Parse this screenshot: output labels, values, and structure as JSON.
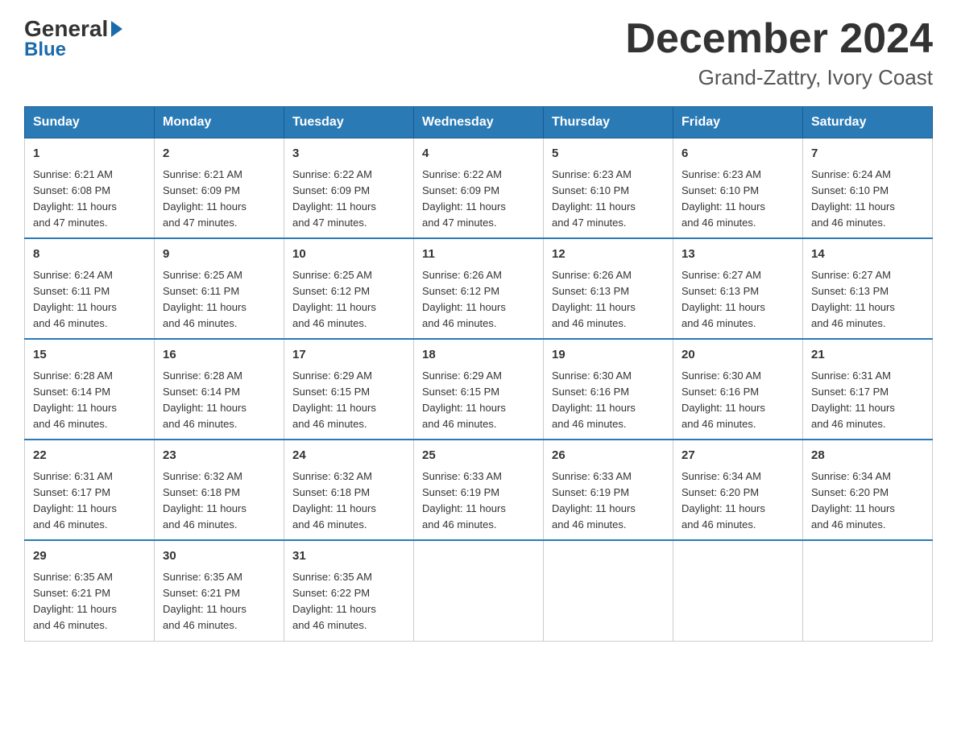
{
  "header": {
    "logo_general": "General",
    "logo_blue": "Blue",
    "month_title": "December 2024",
    "location": "Grand-Zattry, Ivory Coast"
  },
  "days_of_week": [
    "Sunday",
    "Monday",
    "Tuesday",
    "Wednesday",
    "Thursday",
    "Friday",
    "Saturday"
  ],
  "weeks": [
    [
      {
        "day": "1",
        "sunrise": "6:21 AM",
        "sunset": "6:08 PM",
        "daylight": "11 hours and 47 minutes."
      },
      {
        "day": "2",
        "sunrise": "6:21 AM",
        "sunset": "6:09 PM",
        "daylight": "11 hours and 47 minutes."
      },
      {
        "day": "3",
        "sunrise": "6:22 AM",
        "sunset": "6:09 PM",
        "daylight": "11 hours and 47 minutes."
      },
      {
        "day": "4",
        "sunrise": "6:22 AM",
        "sunset": "6:09 PM",
        "daylight": "11 hours and 47 minutes."
      },
      {
        "day": "5",
        "sunrise": "6:23 AM",
        "sunset": "6:10 PM",
        "daylight": "11 hours and 47 minutes."
      },
      {
        "day": "6",
        "sunrise": "6:23 AM",
        "sunset": "6:10 PM",
        "daylight": "11 hours and 46 minutes."
      },
      {
        "day": "7",
        "sunrise": "6:24 AM",
        "sunset": "6:10 PM",
        "daylight": "11 hours and 46 minutes."
      }
    ],
    [
      {
        "day": "8",
        "sunrise": "6:24 AM",
        "sunset": "6:11 PM",
        "daylight": "11 hours and 46 minutes."
      },
      {
        "day": "9",
        "sunrise": "6:25 AM",
        "sunset": "6:11 PM",
        "daylight": "11 hours and 46 minutes."
      },
      {
        "day": "10",
        "sunrise": "6:25 AM",
        "sunset": "6:12 PM",
        "daylight": "11 hours and 46 minutes."
      },
      {
        "day": "11",
        "sunrise": "6:26 AM",
        "sunset": "6:12 PM",
        "daylight": "11 hours and 46 minutes."
      },
      {
        "day": "12",
        "sunrise": "6:26 AM",
        "sunset": "6:13 PM",
        "daylight": "11 hours and 46 minutes."
      },
      {
        "day": "13",
        "sunrise": "6:27 AM",
        "sunset": "6:13 PM",
        "daylight": "11 hours and 46 minutes."
      },
      {
        "day": "14",
        "sunrise": "6:27 AM",
        "sunset": "6:13 PM",
        "daylight": "11 hours and 46 minutes."
      }
    ],
    [
      {
        "day": "15",
        "sunrise": "6:28 AM",
        "sunset": "6:14 PM",
        "daylight": "11 hours and 46 minutes."
      },
      {
        "day": "16",
        "sunrise": "6:28 AM",
        "sunset": "6:14 PM",
        "daylight": "11 hours and 46 minutes."
      },
      {
        "day": "17",
        "sunrise": "6:29 AM",
        "sunset": "6:15 PM",
        "daylight": "11 hours and 46 minutes."
      },
      {
        "day": "18",
        "sunrise": "6:29 AM",
        "sunset": "6:15 PM",
        "daylight": "11 hours and 46 minutes."
      },
      {
        "day": "19",
        "sunrise": "6:30 AM",
        "sunset": "6:16 PM",
        "daylight": "11 hours and 46 minutes."
      },
      {
        "day": "20",
        "sunrise": "6:30 AM",
        "sunset": "6:16 PM",
        "daylight": "11 hours and 46 minutes."
      },
      {
        "day": "21",
        "sunrise": "6:31 AM",
        "sunset": "6:17 PM",
        "daylight": "11 hours and 46 minutes."
      }
    ],
    [
      {
        "day": "22",
        "sunrise": "6:31 AM",
        "sunset": "6:17 PM",
        "daylight": "11 hours and 46 minutes."
      },
      {
        "day": "23",
        "sunrise": "6:32 AM",
        "sunset": "6:18 PM",
        "daylight": "11 hours and 46 minutes."
      },
      {
        "day": "24",
        "sunrise": "6:32 AM",
        "sunset": "6:18 PM",
        "daylight": "11 hours and 46 minutes."
      },
      {
        "day": "25",
        "sunrise": "6:33 AM",
        "sunset": "6:19 PM",
        "daylight": "11 hours and 46 minutes."
      },
      {
        "day": "26",
        "sunrise": "6:33 AM",
        "sunset": "6:19 PM",
        "daylight": "11 hours and 46 minutes."
      },
      {
        "day": "27",
        "sunrise": "6:34 AM",
        "sunset": "6:20 PM",
        "daylight": "11 hours and 46 minutes."
      },
      {
        "day": "28",
        "sunrise": "6:34 AM",
        "sunset": "6:20 PM",
        "daylight": "11 hours and 46 minutes."
      }
    ],
    [
      {
        "day": "29",
        "sunrise": "6:35 AM",
        "sunset": "6:21 PM",
        "daylight": "11 hours and 46 minutes."
      },
      {
        "day": "30",
        "sunrise": "6:35 AM",
        "sunset": "6:21 PM",
        "daylight": "11 hours and 46 minutes."
      },
      {
        "day": "31",
        "sunrise": "6:35 AM",
        "sunset": "6:22 PM",
        "daylight": "11 hours and 46 minutes."
      },
      null,
      null,
      null,
      null
    ]
  ],
  "labels": {
    "sunrise": "Sunrise:",
    "sunset": "Sunset:",
    "daylight": "Daylight:"
  }
}
